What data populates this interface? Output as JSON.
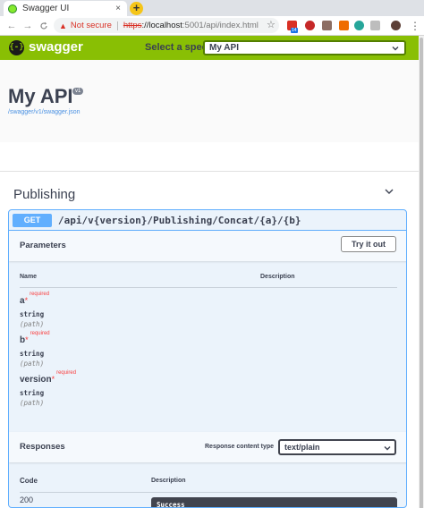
{
  "browser": {
    "tab_title": "Swagger UI",
    "tab_close": "×",
    "new_tab": "+",
    "back": "←",
    "forward": "→",
    "reload": "C",
    "security_label": "Not secure",
    "url_scheme": "https",
    "url_host": "://localhost",
    "url_path": ":5001/api/index.html",
    "extension_badge": "14"
  },
  "swagger_bar": {
    "logo_glyph": "{-}",
    "brand": "swagger",
    "select_label": "Select a spec",
    "selected_spec": "My API"
  },
  "info": {
    "title": "My API",
    "version": "v1",
    "spec_link": "/swagger/v1/swagger.json"
  },
  "tag": {
    "name": "Publishing"
  },
  "operation": {
    "method": "GET",
    "path": "/api/v{version}/Publishing/Concat/{a}/{b}",
    "parameters_title": "Parameters",
    "try_it_out": "Try it out",
    "col_name": "Name",
    "col_description": "Description",
    "required_label": "required",
    "parameters": [
      {
        "name": "a",
        "type": "string",
        "in": "(path)"
      },
      {
        "name": "b",
        "type": "string",
        "in": "(path)"
      },
      {
        "name": "version",
        "type": "string",
        "in": "(path)"
      }
    ],
    "responses_title": "Responses",
    "response_content_type_label": "Response content type",
    "response_content_type": "text/plain",
    "col_code": "Code",
    "col_resp_description": "Description",
    "response_code": "200",
    "response_description": "Success"
  },
  "colors": {
    "swagger_green": "#89bf04",
    "get_blue": "#61affe",
    "required_red": "#f93e3e"
  }
}
